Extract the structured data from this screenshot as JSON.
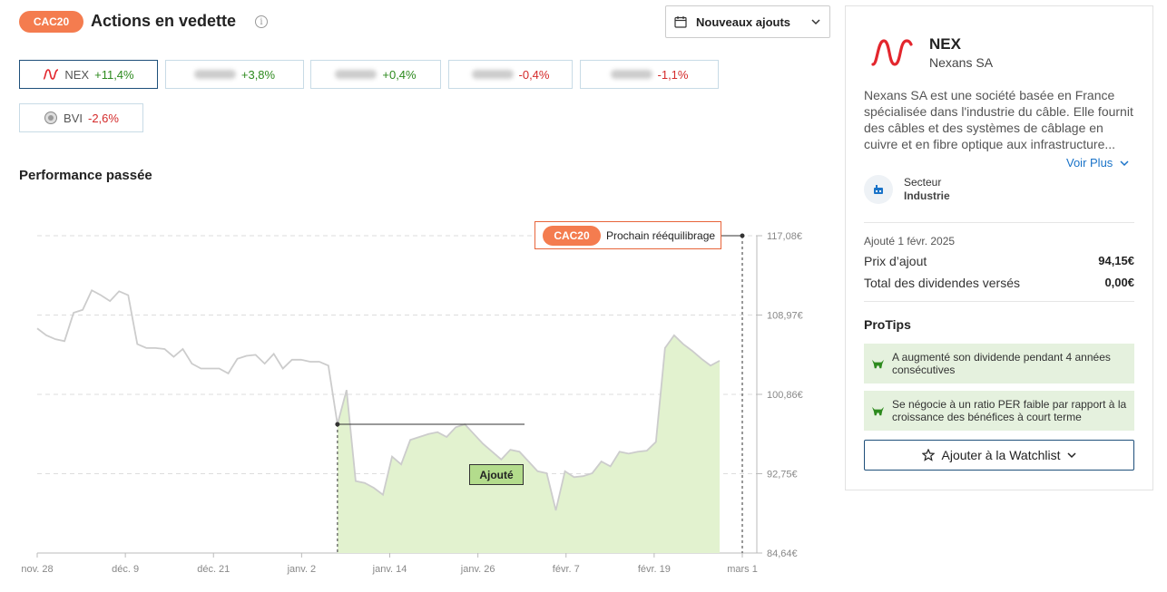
{
  "header": {
    "badge": "CAC20",
    "title": "Actions en vedette",
    "info_icon": "info-icon",
    "sort_label": "Nouveaux ajouts",
    "sort_icon": "calendar-icon"
  },
  "stocks": [
    {
      "symbol": "NEX",
      "change": "+11,4%",
      "trend": "pos",
      "active": true,
      "logo": "nexans-logo"
    },
    {
      "symbol": "",
      "change": "+3,8%",
      "trend": "pos",
      "blurred": true
    },
    {
      "symbol": "",
      "change": "+0,4%",
      "trend": "pos",
      "blurred": true
    },
    {
      "symbol": "",
      "change": "-0,4%",
      "trend": "neg",
      "blurred": true
    },
    {
      "symbol": "",
      "change": "-1,1%",
      "trend": "neg",
      "blurred": true
    },
    {
      "symbol": "BVI",
      "change": "-2,6%",
      "trend": "neg",
      "logo": "bureau-veritas-logo"
    }
  ],
  "performance": {
    "title": "Performance passée",
    "rebalance_badge": "CAC20",
    "rebalance_label": "Prochain rééquilibrage",
    "added_label": "Ajouté"
  },
  "chart_data": {
    "type": "area",
    "x_ticks": [
      "nov. 28",
      "déc. 9",
      "déc. 21",
      "janv. 2",
      "janv. 14",
      "janv. 26",
      "févr. 7",
      "févr. 19",
      "mars 1"
    ],
    "y_ticks": [
      "117,08€",
      "108,97€",
      "100,86€",
      "92,75€",
      "84,64€"
    ],
    "ylim": [
      84.64,
      117.08
    ],
    "added_index": 33,
    "series": [
      {
        "values": [
          107.6,
          106.9,
          106.5,
          106.3,
          109.2,
          109.5,
          111.5,
          111.0,
          110.4,
          111.4,
          111.0,
          106.0,
          105.6,
          105.6,
          105.5,
          104.7,
          105.5,
          104.0,
          103.5,
          103.5,
          103.5,
          103.0,
          104.5,
          104.8,
          104.9,
          104.0,
          105.0,
          103.5,
          104.4,
          104.4,
          104.2,
          104.2,
          103.8,
          97.8,
          101.3,
          92.0,
          91.8,
          91.3,
          90.6,
          94.5,
          93.7,
          96.2,
          96.5,
          96.8,
          97.0,
          96.5,
          97.5,
          97.8,
          96.8,
          95.8,
          95.0,
          94.2,
          95.2,
          95.0,
          94.0,
          93.0,
          92.8,
          89.0,
          93.0,
          92.4,
          92.5,
          92.8,
          94.0,
          93.5,
          95.0,
          94.8,
          95.0,
          95.1,
          96.0,
          105.6,
          106.9,
          106.0,
          105.3,
          104.5,
          103.8,
          104.3
        ],
        "color": "#cccccc"
      }
    ],
    "added_fill_color": "#e2f2cf",
    "grid": true
  },
  "side": {
    "symbol": "NEX",
    "name": "Nexans SA",
    "description": "Nexans SA est une société basée en France spécialisée dans l'industrie du câble. Elle fournit des câbles et des systèmes de câblage en cuivre et en fibre optique aux infrastructure...",
    "more": "Voir Plus",
    "sector_label": "Secteur",
    "sector_value": "Industrie",
    "added_date": "Ajouté 1 févr. 2025",
    "price_label": "Prix d’ajout",
    "price_value": "94,15€",
    "dividends_label": "Total des dividendes versés",
    "dividends_value": "0,00€",
    "protips_title": "ProTips",
    "tips": [
      "A augmenté son dividende pendant 4 années consécutives",
      "Se négocie à un ratio PER faible par rapport à la croissance des bénéfices à court terme"
    ],
    "watchlist_label": "Ajouter à la Watchlist"
  },
  "colors": {
    "accent": "#f47c4f",
    "positive": "#2d8a1e",
    "negative": "#d42a2a",
    "link": "#1a73c8",
    "logo_red": "#e3262d"
  }
}
